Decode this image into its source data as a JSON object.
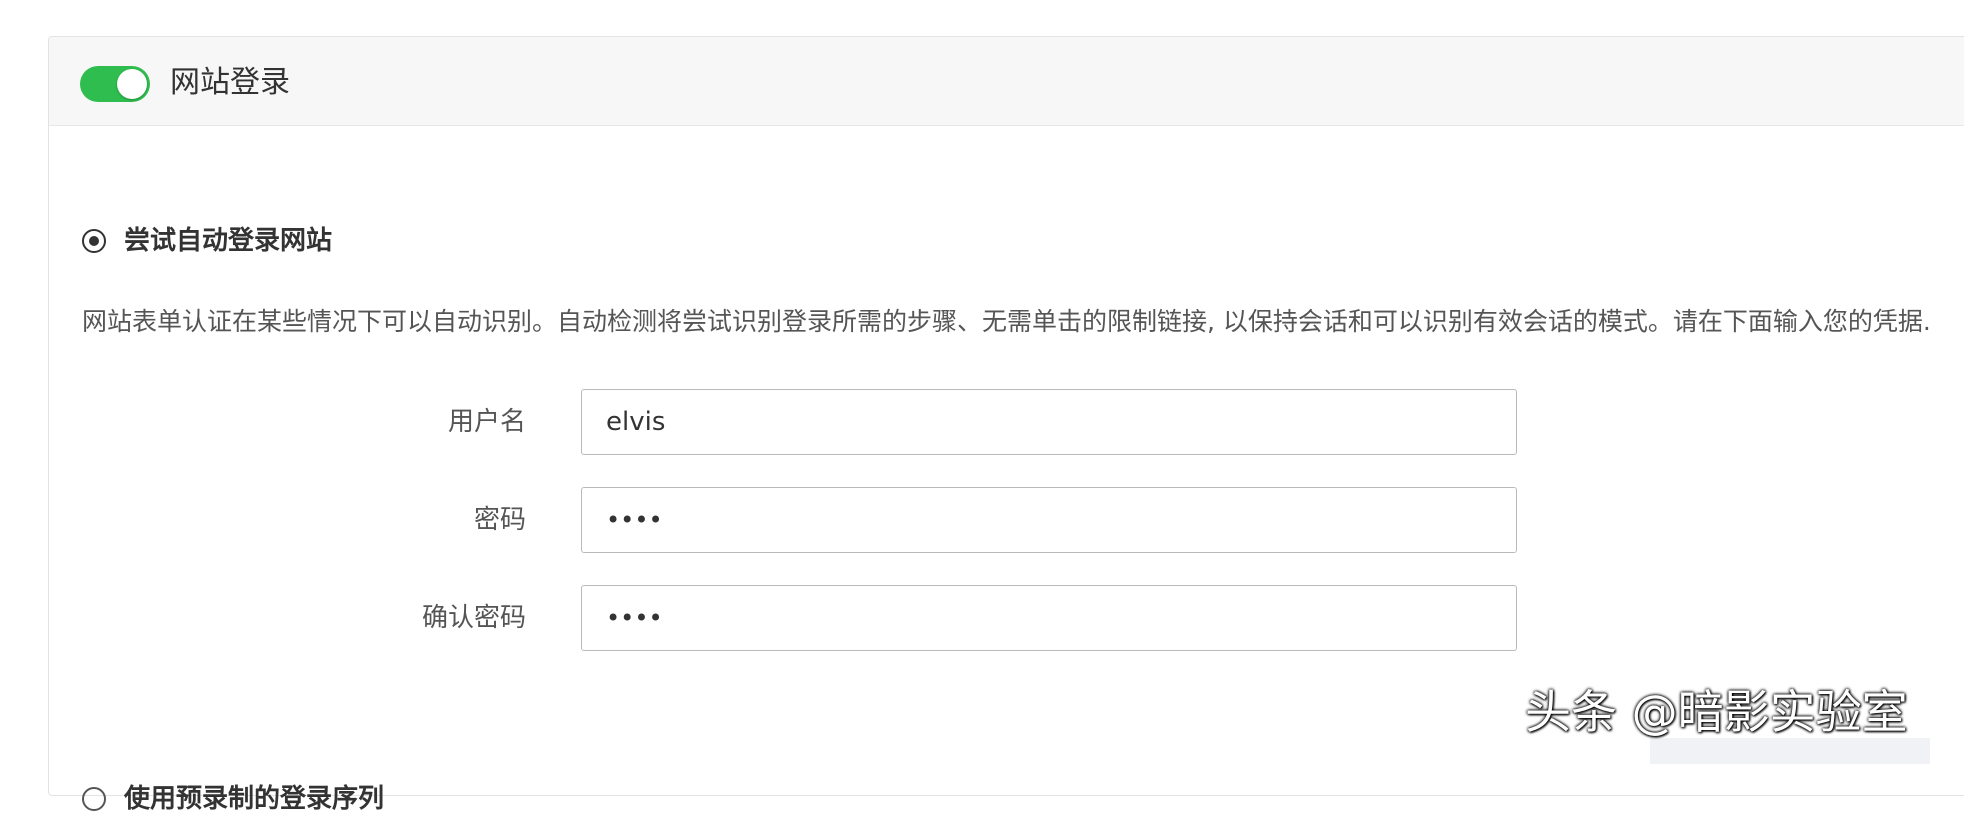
{
  "header": {
    "toggle_state": "on",
    "toggle_color": "#2ebd4e",
    "title": "网站登录"
  },
  "auto_login": {
    "selected": true,
    "label": "尝试自动登录网站",
    "description": "网站表单认证在某些情况下可以自动识别。自动检测将尝试识别登录所需的步骤、无需单击的限制链接, 以保持会话和可以识别有效会话的模式。请在下面输入您的凭据."
  },
  "form": {
    "username_label": "用户名",
    "username_value": "elvis",
    "password_label": "密码",
    "password_value": "••••",
    "confirm_label": "确认密码",
    "confirm_value": "••••"
  },
  "recorded_sequence": {
    "selected": false,
    "label": "使用预录制的登录序列"
  },
  "watermark": {
    "text": "头条 @暗影实验室"
  }
}
